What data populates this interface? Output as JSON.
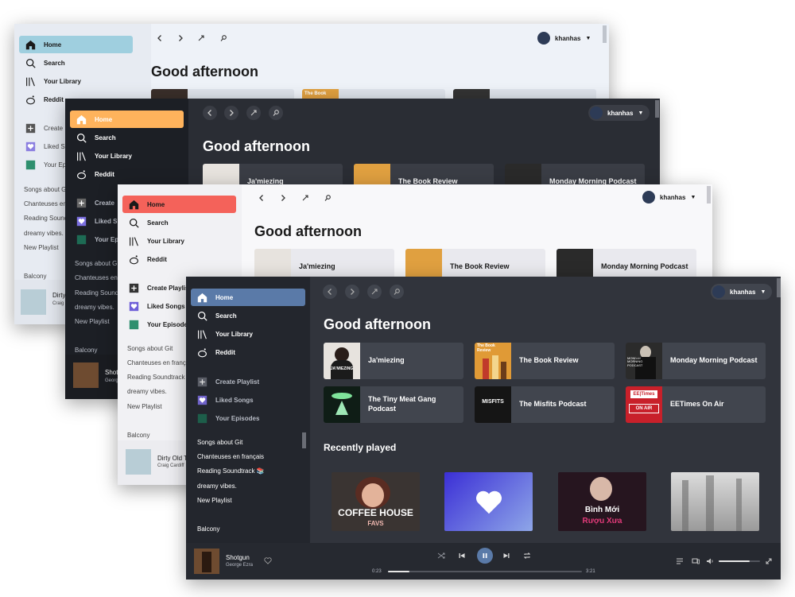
{
  "user": {
    "name": "khanhas"
  },
  "greeting": "Good afternoon",
  "nav": {
    "home": "Home",
    "search": "Search",
    "library": "Your Library",
    "reddit": "Reddit"
  },
  "actions": {
    "create": "Create Playlist",
    "liked": "Liked Songs",
    "episodes": "Your Episodes"
  },
  "playlists": [
    "Songs about Git",
    "Chanteuses en français",
    "Reading Soundtrack 📚",
    "dreamy vibes.",
    "New Playlist",
    "Balcony"
  ],
  "w1": {
    "create": "Create",
    "liked": "Liked S",
    "episodes": "Your Ep",
    "pl": [
      "Songs about G",
      "Chanteuses en",
      "Reading Sound",
      "dreamy vibes.",
      "New Playlist",
      "Balcony"
    ],
    "np_title": "Dirty",
    "np_artist": "Craig"
  },
  "w2": {
    "create": "Create",
    "liked": "Liked S",
    "episodes": "Your Ep",
    "pl": [
      "Songs about G",
      "Chanteuses en",
      "Reading Sound",
      "dreamy vibes.",
      "New Playlist",
      "Balcony"
    ],
    "np_title": "Shotg",
    "np_artist": "Georg",
    "cards": [
      "Ja'miezing",
      "The Book Review",
      "Monday Morning Podcast"
    ]
  },
  "w3": {
    "create": "Create Playlis",
    "liked": "Liked Songs",
    "episodes": "Your Episode",
    "pl": [
      "Songs about Git",
      "Chanteuses en françai",
      "Reading Soundtrack",
      "dreamy vibes.",
      "New Playlist",
      "Balcony"
    ],
    "np_title": "Dirty Old T",
    "np_artist": "Craig Cardiff",
    "cards": [
      "Ja'miezing",
      "The Book Review",
      "Monday Morning Podcast"
    ]
  },
  "w1cards": [
    "",
    "The Book",
    ""
  ],
  "shortcuts": [
    "Ja'miezing",
    "The Book Review",
    "Monday Morning Podcast",
    "The Tiny Meat Gang Podcast",
    "The Misfits Podcast",
    "EETimes On Air"
  ],
  "art_text": {
    "jamie": "JA'MIEZING",
    "book": "The Book Review",
    "monday": "MONDAY MORNING PODCAST",
    "misfits": "MISFITS",
    "eetimes_logo": "EE|Times",
    "onair": "ON AIR",
    "coffee": "COFFEE HOUSE",
    "coffee_sub": "FAVS",
    "binh1": "Bình Mới",
    "binh2": "Rượu Xưa"
  },
  "recently_played_title": "Recently played",
  "now_playing": {
    "title": "Shotgun",
    "artist": "George Ezra",
    "elapsed": "0:23",
    "duration": "3:21",
    "progress": 0.11,
    "volume": 0.75
  },
  "colors": {
    "w1_accent": "#9fcfdf",
    "w2_accent": "#ffb35c",
    "w3_accent": "#f4625a",
    "w4_accent": "#5a7aa8"
  }
}
